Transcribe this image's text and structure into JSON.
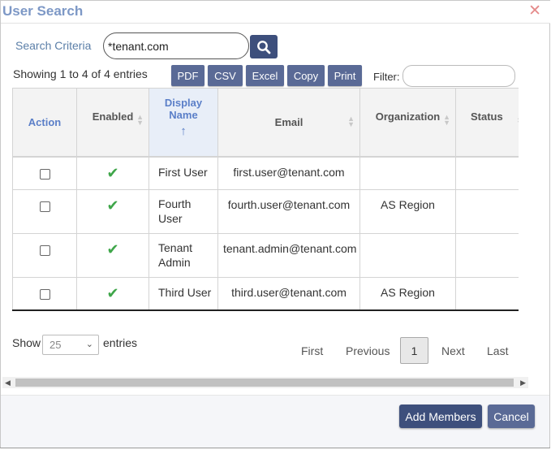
{
  "dialog": {
    "title": "User Search",
    "close_glyph": "✕"
  },
  "search": {
    "label": "Search Criteria",
    "value": "*tenant.com"
  },
  "summary": "Showing 1 to 4 of 4 entries",
  "export_buttons": [
    "PDF",
    "CSV",
    "Excel",
    "Copy",
    "Print"
  ],
  "filter": {
    "label": "Filter:",
    "value": ""
  },
  "table": {
    "headers": {
      "action": "Action",
      "enabled": "Enabled",
      "display_name": "Display Name",
      "display_name_sort": "↑",
      "email": "Email",
      "organization": "Organization",
      "status": "Status"
    },
    "rows": [
      {
        "enabled": "✔",
        "display_name": "First User",
        "email": "first.user@tenant.com",
        "organization": "",
        "status": ""
      },
      {
        "enabled": "✔",
        "display_name": "Fourth User",
        "email": "fourth.user@tenant.com",
        "organization": "AS Region",
        "status": ""
      },
      {
        "enabled": "✔",
        "display_name": "Tenant Admin",
        "email": "tenant.admin@tenant.com",
        "organization": "",
        "status": ""
      },
      {
        "enabled": "✔",
        "display_name": "Third User",
        "email": "third.user@tenant.com",
        "organization": "AS Region",
        "status": ""
      }
    ]
  },
  "length": {
    "show_label": "Show",
    "selected": "25",
    "entries_label": "entries"
  },
  "pagination": {
    "first": "First",
    "previous": "Previous",
    "current": "1",
    "next": "Next",
    "last": "Last"
  },
  "footer": {
    "add_members": "Add Members",
    "cancel": "Cancel"
  },
  "colors": {
    "accent": "#3d4f7c",
    "export_button": "#5a6a96",
    "check": "#3fa64a",
    "title": "#7d98c6"
  }
}
